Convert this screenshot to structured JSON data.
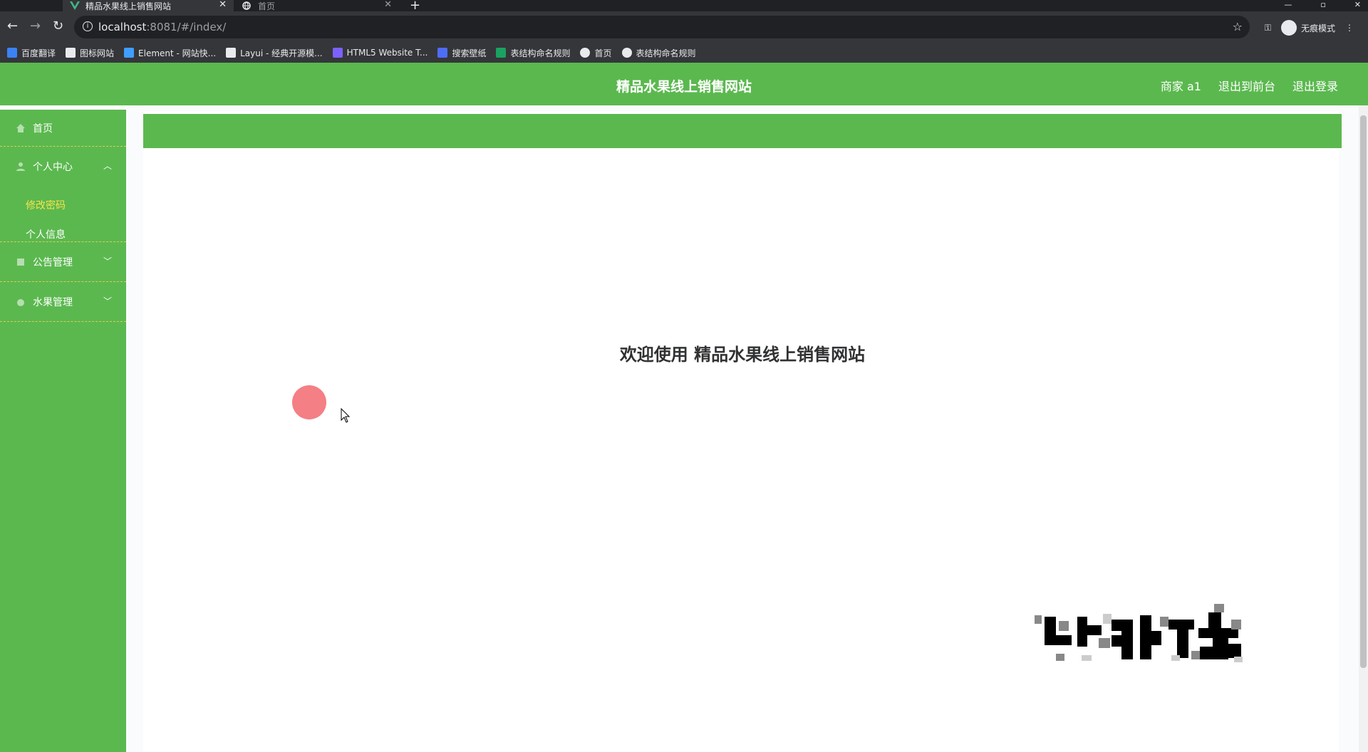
{
  "browser": {
    "tabs": [
      {
        "title": "精品水果线上销售网站",
        "active": true
      },
      {
        "title": "首页",
        "active": false
      }
    ],
    "new_tab_icon": "plus-icon",
    "url_host": "localhost",
    "url_rest": ":8081/#/index/",
    "incognito_label": "无痕模式",
    "bookmarks": [
      {
        "label": "百度翻译",
        "icon": "baidu-translate-icon",
        "color": "#3b82f6"
      },
      {
        "label": "图标网站",
        "icon": "flag-icon",
        "color": "#e8eaed"
      },
      {
        "label": "Element - 网站快...",
        "icon": "element-icon",
        "color": "#409eff"
      },
      {
        "label": "Layui - 经典开源模...",
        "icon": "layui-icon",
        "color": "#e8eaed"
      },
      {
        "label": "HTML5 Website T...",
        "icon": "html5-icon",
        "color": "#7b61ff"
      },
      {
        "label": "搜索壁纸",
        "icon": "wallpaper-icon",
        "color": "#4f6cf7"
      },
      {
        "label": "表结构命名规则",
        "icon": "sheet-icon",
        "color": "#1aa260"
      },
      {
        "label": "首页",
        "icon": "globe-icon",
        "color": "#e8eaed"
      },
      {
        "label": "表结构命名规则",
        "icon": "globe-icon",
        "color": "#e8eaed"
      }
    ]
  },
  "header": {
    "title": "精品水果线上销售网站",
    "links": [
      "商家 a1",
      "退出到前台",
      "退出登录"
    ]
  },
  "sidebar": {
    "items": [
      {
        "label": "首页",
        "icon": "home-icon"
      },
      {
        "label": "个人中心",
        "icon": "user-icon",
        "arrow": "chevron-up-icon"
      },
      {
        "label": "公告管理",
        "icon": "notice-icon",
        "arrow": "chevron-down-icon"
      },
      {
        "label": "水果管理",
        "icon": "fruit-icon",
        "arrow": "chevron-down-icon"
      }
    ],
    "submenu": [
      "修改密码",
      "个人信息"
    ]
  },
  "main": {
    "welcome": "欢迎使用 精品水果线上销售网站"
  },
  "colors": {
    "primary_green": "#5bb84f",
    "active_submenu": "#f7e34a",
    "cursor_dot": "#f47f84"
  }
}
